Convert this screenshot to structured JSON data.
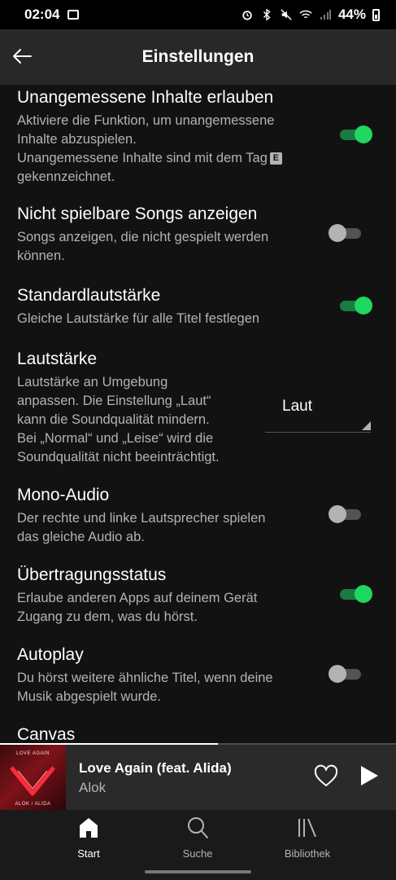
{
  "status_bar": {
    "time": "02:04",
    "battery": "44%",
    "icons": [
      "gallery-icon",
      "alarm-icon",
      "bluetooth-icon",
      "mute-icon",
      "wifi-icon",
      "signal-icon",
      "battery-icon"
    ]
  },
  "header": {
    "title": "Einstellungen",
    "back_icon": "arrow-left-icon"
  },
  "settings": [
    {
      "title": "Unangemessene Inhalte erlauben",
      "desc_lines": [
        "Aktiviere die Funktion, um unangemessene",
        "Inhalte abzuspielen.",
        "Unangemessene Inhalte sind mit dem Tag",
        "gekennzeichnet."
      ],
      "tag": "E",
      "control": "toggle",
      "enabled": true
    },
    {
      "title": "Nicht spielbare Songs anzeigen",
      "desc_lines": [
        "Songs anzeigen, die nicht gespielt werden",
        "können."
      ],
      "control": "toggle",
      "enabled": false
    },
    {
      "title": "Standardlautstärke",
      "desc_lines": [
        "Gleiche Lautstärke für alle Titel festlegen"
      ],
      "control": "toggle",
      "enabled": true
    },
    {
      "title": "Lautstärke",
      "desc_lines": [
        "Lautstärke an Umgebung",
        "anpassen. Die Einstellung „Laut“",
        "kann die Soundqualität mindern.",
        "Bei „Normal“ und „Leise“ wird die",
        "Soundqualität nicht beeinträchtigt."
      ],
      "control": "dropdown",
      "value": "Laut"
    },
    {
      "title": "Mono-Audio",
      "desc_lines": [
        "Der rechte und linke Lautsprecher spielen",
        "das gleiche Audio ab."
      ],
      "control": "toggle",
      "enabled": false
    },
    {
      "title": "Übertragungsstatus",
      "desc_lines": [
        "Erlaube anderen Apps auf deinem Gerät",
        "Zugang zu dem, was du hörst."
      ],
      "control": "toggle",
      "enabled": true
    },
    {
      "title": "Autoplay",
      "desc_lines": [
        "Du hörst weitere ähnliche Titel, wenn deine",
        "Musik abgespielt wurde."
      ],
      "control": "toggle",
      "enabled": false
    },
    {
      "title": "Canvas",
      "desc_lines": []
    }
  ],
  "now_playing": {
    "title": "Love Again (feat. Alida)",
    "artist": "Alok",
    "cover_text_top": "LOVE AGAIN",
    "cover_text_bottom": "ALOK / ALIDA",
    "progress": 0.55,
    "icons": [
      "heart-icon",
      "play-icon"
    ]
  },
  "nav": {
    "items": [
      {
        "label": "Start",
        "icon": "home-icon",
        "active": true
      },
      {
        "label": "Suche",
        "icon": "search-icon",
        "active": false
      },
      {
        "label": "Bibliothek",
        "icon": "library-icon",
        "active": false
      }
    ]
  },
  "colors": {
    "accent": "#1ed760",
    "background": "#121212",
    "header": "#282828",
    "text_secondary": "#b3b3b3"
  }
}
